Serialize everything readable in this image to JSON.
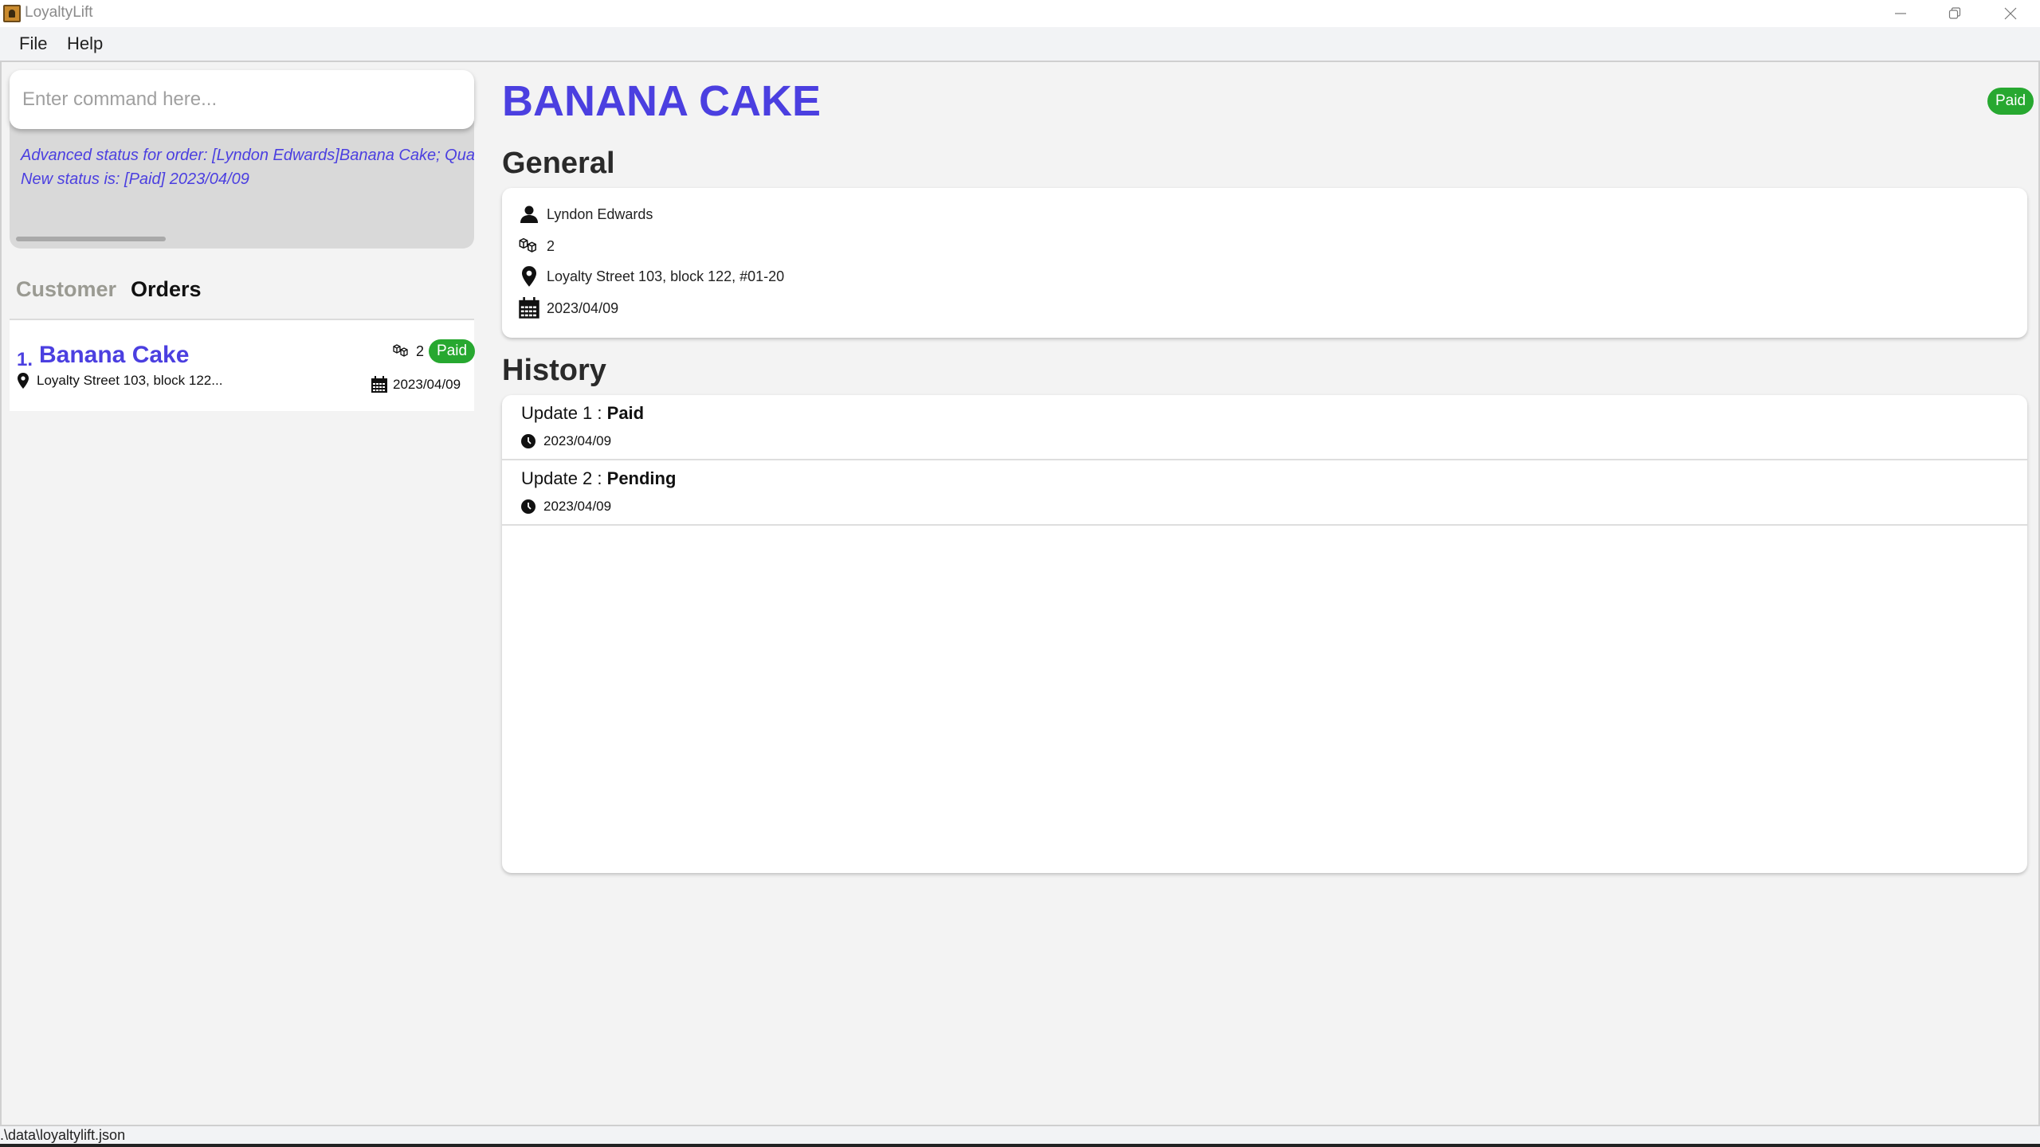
{
  "window": {
    "title": "LoyaltyLift",
    "controls": {
      "minimize": "—",
      "restore": "❐",
      "close": "✕"
    }
  },
  "menu": {
    "file": "File",
    "help": "Help"
  },
  "command": {
    "placeholder": "Enter command here...",
    "value": ""
  },
  "result": {
    "line1": "Advanced status for order: [Lyndon Edwards]Banana Cake; Quanti",
    "line2": "New status is: [Paid] 2023/04/09"
  },
  "tabs": [
    {
      "label": "Customer",
      "active": false
    },
    {
      "label": "Orders",
      "active": true
    }
  ],
  "orders": [
    {
      "index": "1.",
      "name": "Banana Cake",
      "quantity": "2",
      "status": "Paid",
      "address": "Loyalty Street 103, block 122...",
      "date": "2023/04/09"
    }
  ],
  "detail": {
    "title": "BANANA CAKE",
    "status": "Paid",
    "general_heading": "General",
    "customer": "Lyndon Edwards",
    "quantity": "2",
    "address": "Loyalty Street 103, block 122, #01-20",
    "date": "2023/04/09",
    "history_heading": "History",
    "history": [
      {
        "prefix": "Update 1 : ",
        "status": "Paid",
        "date": "2023/04/09"
      },
      {
        "prefix": "Update 2 : ",
        "status": "Pending",
        "date": "2023/04/09"
      }
    ]
  },
  "statusbar": {
    "path": ".\\data\\loyaltylift.json"
  },
  "colors": {
    "accent": "#4b3fe0",
    "paid_badge": "#27a830",
    "result_bg": "#d9d9d9"
  },
  "icons": {
    "customer": "person-icon",
    "quantity": "boxes-icon",
    "address": "map-pin-icon",
    "date": "calendar-icon",
    "history_time": "clock-icon"
  }
}
